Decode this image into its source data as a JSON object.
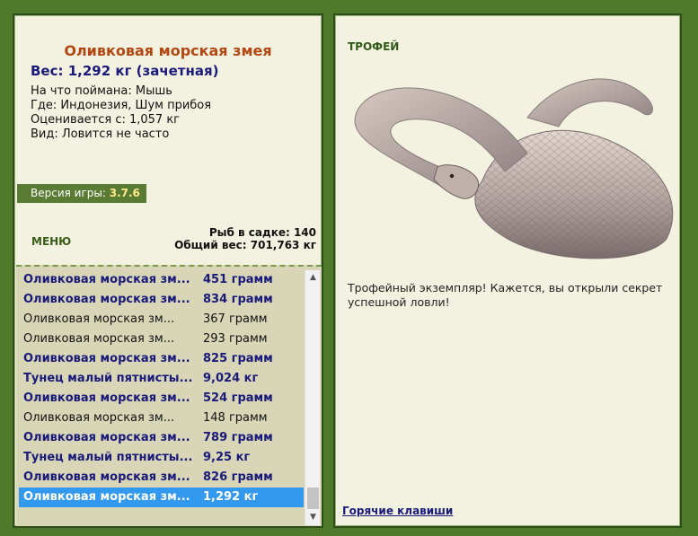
{
  "fish": {
    "title": "Оливковая морская змея",
    "weight_line": "Вес: 1,292 кг (зачетная)",
    "caught_on": "На что поймана: Мышь",
    "location": "Где: Индонезия, Шум прибоя",
    "valued_from": "Оценивается с: 1,057 кг",
    "rarity": "Вид: Ловится не часто"
  },
  "version": {
    "label": "Версия игры:",
    "value": "3.7.6"
  },
  "menu_label": "МЕНЮ",
  "stats": {
    "fish_count": "Рыб в садке: 140",
    "total_weight": "Общий вес: 701,763 кг"
  },
  "catch_list": [
    {
      "name": "Оливковая морская зм...",
      "weight": "451 грамм",
      "style": "bold"
    },
    {
      "name": "Оливковая морская зм...",
      "weight": "834 грамм",
      "style": "bold"
    },
    {
      "name": "Оливковая морская зм...",
      "weight": "367 грамм",
      "style": "normal"
    },
    {
      "name": "Оливковая морская зм...",
      "weight": "293 грамм",
      "style": "normal"
    },
    {
      "name": "Оливковая морская зм...",
      "weight": "825 грамм",
      "style": "bold"
    },
    {
      "name": "Тунец малый пятнисты...",
      "weight": "9,024 кг",
      "style": "bold"
    },
    {
      "name": "Оливковая морская зм...",
      "weight": "524 грамм",
      "style": "bold"
    },
    {
      "name": "Оливковая морская зм...",
      "weight": "148 грамм",
      "style": "normal"
    },
    {
      "name": "Оливковая морская зм...",
      "weight": "789 грамм",
      "style": "bold"
    },
    {
      "name": "Тунец малый пятнисты...",
      "weight": "9,25 кг",
      "style": "bold"
    },
    {
      "name": "Оливковая морская зм...",
      "weight": "826 грамм",
      "style": "bold"
    },
    {
      "name": "Оливковая морская зм...",
      "weight": "1,292 кг",
      "style": "selected"
    }
  ],
  "trophy": {
    "label": "ТРОФЕЙ",
    "text": "Трофейный экземпляр! Кажется, вы открыли секрет успешной ловли!",
    "image_icon": "snake-image"
  },
  "hotkeys_label": "Горячие клавиши",
  "colors": {
    "background": "#4f7a2c",
    "panel": "#f3f1e0",
    "title": "#b34712",
    "accent_blue": "#1a1a7a",
    "selection": "#3399ee"
  }
}
